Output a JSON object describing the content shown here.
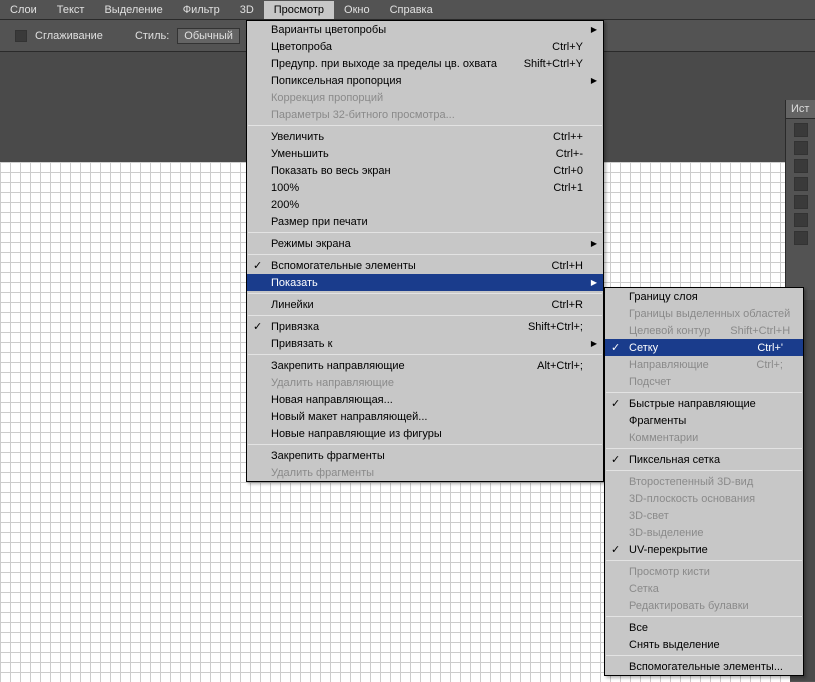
{
  "menubar": [
    "Слои",
    "Текст",
    "Выделение",
    "Фильтр",
    "3D",
    "Просмотр",
    "Окно",
    "Справка"
  ],
  "toolbar": {
    "smoothing": "Сглаживание",
    "style": "Стиль:",
    "style_val": "Обычный"
  },
  "panel": {
    "tab": "Ист"
  },
  "menu1": [
    {
      "t": "item",
      "l": "Варианты цветопробы",
      "arrow": true
    },
    {
      "t": "item",
      "l": "Цветопроба",
      "sc": "Ctrl+Y"
    },
    {
      "t": "item",
      "l": "Предупр. при выходе за пределы цв. охвата",
      "sc": "Shift+Ctrl+Y"
    },
    {
      "t": "item",
      "l": "Попиксельная пропорция",
      "arrow": true
    },
    {
      "t": "item",
      "l": "Коррекция пропорций",
      "dis": true
    },
    {
      "t": "item",
      "l": "Параметры 32-битного просмотра...",
      "dis": true
    },
    {
      "t": "sep"
    },
    {
      "t": "item",
      "l": "Увеличить",
      "sc": "Ctrl++"
    },
    {
      "t": "item",
      "l": "Уменьшить",
      "sc": "Ctrl+-"
    },
    {
      "t": "item",
      "l": "Показать во весь экран",
      "sc": "Ctrl+0"
    },
    {
      "t": "item",
      "l": "100%",
      "sc": "Ctrl+1"
    },
    {
      "t": "item",
      "l": "200%"
    },
    {
      "t": "item",
      "l": "Размер при печати"
    },
    {
      "t": "sep"
    },
    {
      "t": "item",
      "l": "Режимы экрана",
      "arrow": true
    },
    {
      "t": "sep"
    },
    {
      "t": "item",
      "l": "Вспомогательные элементы",
      "sc": "Ctrl+H",
      "chk": true
    },
    {
      "t": "item",
      "l": "Показать",
      "arrow": true,
      "hl": true
    },
    {
      "t": "sep"
    },
    {
      "t": "item",
      "l": "Линейки",
      "sc": "Ctrl+R"
    },
    {
      "t": "sep"
    },
    {
      "t": "item",
      "l": "Привязка",
      "sc": "Shift+Ctrl+;",
      "chk": true
    },
    {
      "t": "item",
      "l": "Привязать к",
      "arrow": true
    },
    {
      "t": "sep"
    },
    {
      "t": "item",
      "l": "Закрепить направляющие",
      "sc": "Alt+Ctrl+;"
    },
    {
      "t": "item",
      "l": "Удалить направляющие",
      "dis": true
    },
    {
      "t": "item",
      "l": "Новая направляющая..."
    },
    {
      "t": "item",
      "l": "Новый макет направляющей..."
    },
    {
      "t": "item",
      "l": "Новые направляющие из фигуры"
    },
    {
      "t": "sep"
    },
    {
      "t": "item",
      "l": "Закрепить фрагменты"
    },
    {
      "t": "item",
      "l": "Удалить фрагменты",
      "dis": true
    }
  ],
  "menu2": [
    {
      "t": "item",
      "l": "Границу слоя"
    },
    {
      "t": "item",
      "l": "Границы выделенных областей",
      "dis": true
    },
    {
      "t": "item",
      "l": "Целевой контур",
      "sc": "Shift+Ctrl+H",
      "dis": true
    },
    {
      "t": "item",
      "l": "Сетку",
      "sc": "Ctrl+'",
      "chk": true,
      "hl": true
    },
    {
      "t": "item",
      "l": "Направляющие",
      "sc": "Ctrl+;",
      "dis": true
    },
    {
      "t": "item",
      "l": "Подсчет",
      "dis": true
    },
    {
      "t": "sep"
    },
    {
      "t": "item",
      "l": "Быстрые направляющие",
      "chk": true
    },
    {
      "t": "item",
      "l": "Фрагменты"
    },
    {
      "t": "item",
      "l": "Комментарии",
      "dis": true
    },
    {
      "t": "sep"
    },
    {
      "t": "item",
      "l": "Пиксельная сетка",
      "chk": true
    },
    {
      "t": "sep"
    },
    {
      "t": "item",
      "l": "Второстепенный 3D-вид",
      "dis": true
    },
    {
      "t": "item",
      "l": "3D-плоскость основания",
      "dis": true
    },
    {
      "t": "item",
      "l": "3D-свет",
      "dis": true
    },
    {
      "t": "item",
      "l": "3D-выделение",
      "dis": true
    },
    {
      "t": "item",
      "l": "UV-перекрытие",
      "chk": true
    },
    {
      "t": "sep"
    },
    {
      "t": "item",
      "l": "Просмотр кисти",
      "dis": true
    },
    {
      "t": "item",
      "l": "Сетка",
      "dis": true
    },
    {
      "t": "item",
      "l": "Редактировать булавки",
      "dis": true
    },
    {
      "t": "sep"
    },
    {
      "t": "item",
      "l": "Все"
    },
    {
      "t": "item",
      "l": "Снять выделение"
    },
    {
      "t": "sep"
    },
    {
      "t": "item",
      "l": "Вспомогательные элементы..."
    }
  ]
}
